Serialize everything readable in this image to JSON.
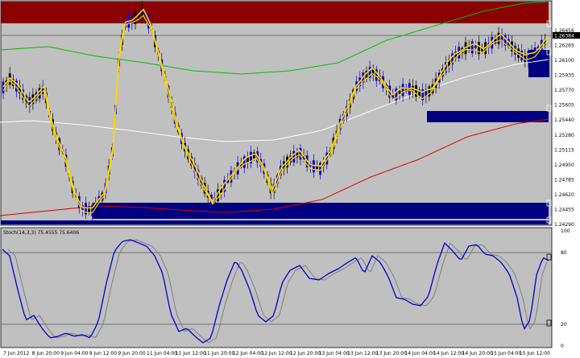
{
  "indicator": {
    "label": "Stoch(14,3,3) 75.4555 75.6406"
  },
  "price_axis": {
    "labels": [
      "1.26456",
      "1.26265",
      "1.26100",
      "1.25935",
      "1.25770",
      "1.25605",
      "1.25440",
      "1.25280",
      "1.25115",
      "1.24950",
      "1.24785",
      "1.24620",
      "1.24455",
      "1.24290"
    ],
    "current": "1.26384"
  },
  "stoch_axis": {
    "labels": [
      "100",
      "80",
      "20",
      "0"
    ]
  },
  "time_axis": {
    "labels": [
      "7 Jun 2012",
      "8 Jun 20:00",
      "9 Jun 04:00",
      "9 Jun 12:00",
      "9 Jun 20:00",
      "11 Jun 04:00",
      "11 Jun 12:00",
      "11 Jun 20:00",
      "12 Jun 04:00",
      "12 Jun 12:00",
      "12 Jun 20:00",
      "13 Jun 04:00",
      "13 Jun 12:00",
      "13 Jun 20:00",
      "14 Jun 04:00",
      "14 Jun 12:00",
      "14 Jun 20:00",
      "15 Jun 04:00",
      "15 Jun 12:00"
    ]
  },
  "colors": {
    "background": "#c0c0c0",
    "bull": "#0000cc",
    "bear": "#000000",
    "resistance_zone": "#8b0000",
    "support_zone": "#000080",
    "ma_slow": "#00c000",
    "ma_mid": "#ffffff",
    "ma_long": "#dd0000",
    "envelope": "#ffd700",
    "stoch_main": "#0000cc",
    "stoch_signal": "#808080"
  }
}
